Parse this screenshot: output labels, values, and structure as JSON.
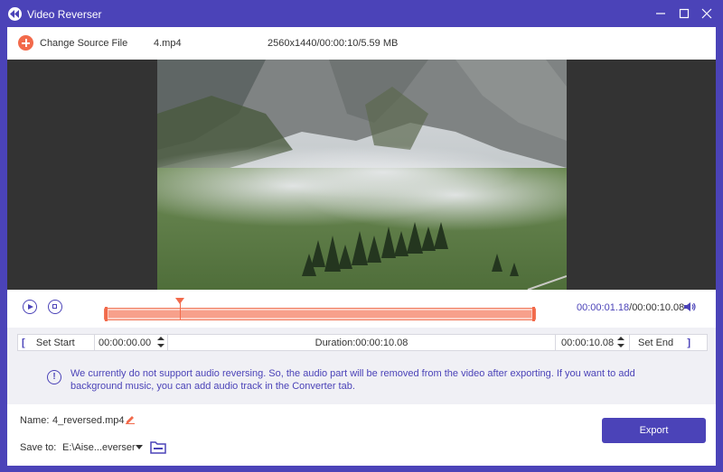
{
  "window": {
    "title": "Video Reverser",
    "icons": {
      "app": "rewind-icon",
      "minimize": "minimize-icon",
      "maximize": "maximize-icon",
      "close": "close-icon"
    }
  },
  "source": {
    "change_label": "Change Source File",
    "file_name": "4.mp4",
    "file_info": "2560x1440/00:00:10/5.59 MB"
  },
  "player": {
    "current_time": "00:00:01.18",
    "separator": "/",
    "total_time": "00:00:10.08",
    "playhead_fraction": 0.17
  },
  "trim": {
    "set_start_label": "Set Start",
    "start_time": "00:00:00.00",
    "duration": "Duration:00:00:10.08",
    "end_time": "00:00:10.08",
    "set_end_label": "Set End",
    "bracket_open": "[",
    "bracket_close": "]"
  },
  "notice": {
    "icon": "!",
    "text": "We currently do not support audio reversing. So, the audio part will be removed from the video after exporting. If you want to add background music, you can add audio track in the Converter tab."
  },
  "output": {
    "name_label": "Name:",
    "name_value": "4_reversed.mp4",
    "save_label": "Save to:",
    "save_path": "E:\\Aise...everser",
    "export_label": "Export"
  },
  "colors": {
    "accent": "#4b43b8",
    "orange": "#f26a4b",
    "background": "#f0f0f5"
  }
}
